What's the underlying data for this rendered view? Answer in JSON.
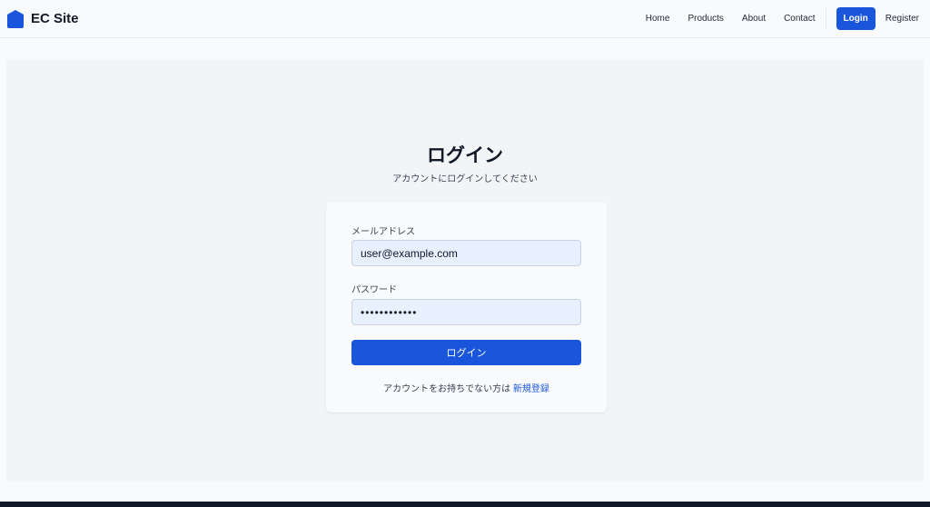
{
  "header": {
    "brand": "EC Site",
    "nav": [
      "Home",
      "Products",
      "About",
      "Contact"
    ],
    "login": "Login",
    "register": "Register"
  },
  "page": {
    "title": "ログイン",
    "subtitle": "アカウントにログインしてください"
  },
  "form": {
    "email_label": "メールアドレス",
    "email_value": "user@example.com",
    "password_label": "パスワード",
    "password_value": "••••••••••••",
    "submit": "ログイン",
    "no_account": "アカウントをお持ちでない方は",
    "signup": "新規登録"
  },
  "colors": {
    "primary": "#1a56db",
    "input_bg": "#e8effd"
  }
}
